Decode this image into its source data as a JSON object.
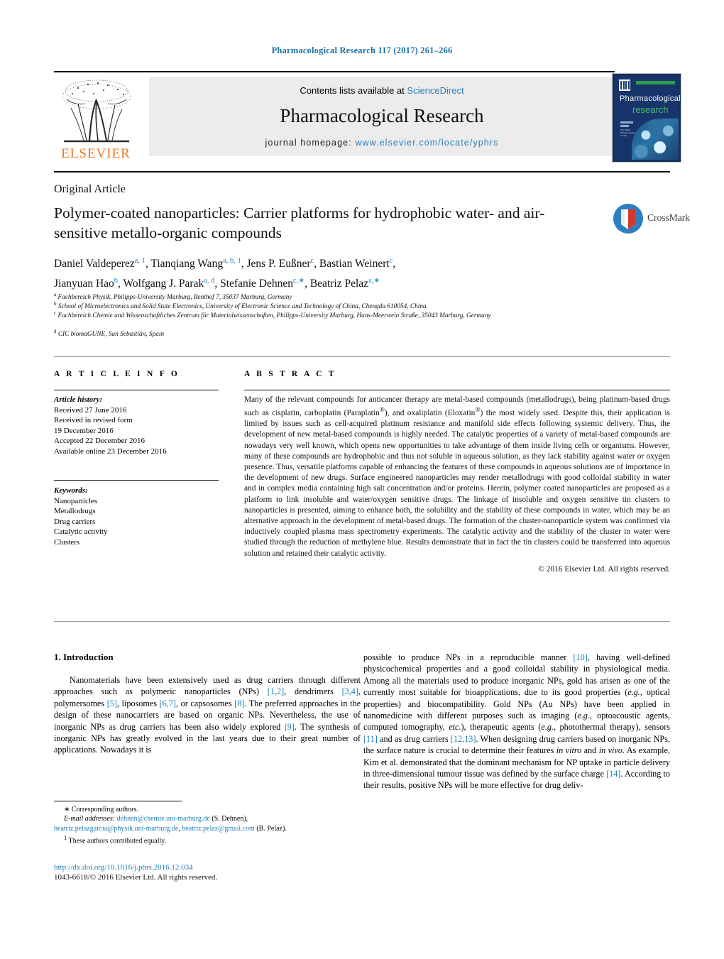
{
  "running_head": "Pharmacological Research 117 (2017) 261–266",
  "masthead": {
    "contents_prefix": "Contents lists available at ",
    "sciencedirect": "ScienceDirect",
    "journal_title": "Pharmacological Research",
    "homepage_label": "journal homepage:",
    "homepage_url": "www.elsevier.com/locate/yphrs",
    "publisher": "ELSEVIER",
    "cover": {
      "line1": "Pharmacological",
      "line2": "research",
      "mini_text": "The Italian Pharmacological Society"
    }
  },
  "article": {
    "type": "Original Article",
    "title": "Polymer-coated nanoparticles: Carrier platforms for hydrophobic water- and air-sensitive metallo-organic compounds",
    "crossmark_label": "CrossMark",
    "authors_line1_html": "Daniel Valdeperez<sup>a, 1</sup>, Tianqiang Wang<sup>a, b, 1</sup>, Jens P. Eußner<sup>c</sup>, Bastian Weinert<sup>c</sup>,",
    "authors_line2_html": "Jianyuan Hao<sup>b</sup>, Wolfgang J. Parak<sup>a, d</sup>, Stefanie Dehnen<sup>c,∗</sup>, Beatriz Pelaz<sup>a,∗</sup>",
    "affiliations": [
      {
        "mark": "a",
        "text": "Fachbereich Physik, Philipps-University Marburg, Renthof 7, 35037 Marburg, Germany"
      },
      {
        "mark": "b",
        "text": "School of Microelectronics and Solid State Electronics, University of Electronic Science and Technology of China, Chengdu 610054, China"
      },
      {
        "mark": "c",
        "text": "Fachbereich Chemie and Wissenschaftliches Zentrum für Materialwissenschaften, Philipps-University Marburg, Hans-Meerwein Straße, 35043 Marburg, Germany"
      },
      {
        "mark": "d",
        "text": "CIC biomaGUNE, San Sebastián, Spain"
      }
    ]
  },
  "article_info": {
    "heading": "A R T I C L E    I N F O",
    "history_label": "Article history:",
    "history": [
      "Received 27 June 2016",
      "Received in revised form",
      "19 December 2016",
      "Accepted 22 December 2016",
      "Available online 23 December 2016"
    ],
    "keywords_label": "Keywords:",
    "keywords": [
      "Nanoparticles",
      "Metallodrugs",
      "Drug carriers",
      "Catalytic activity",
      "Clusters"
    ]
  },
  "abstract": {
    "heading": "A B S T R A C T",
    "text_html": "Many of the relevant compounds for anticancer therapy are metal-based compounds (metallodrugs), being platinum-based drugs such as cisplatin, carboplatin (Paraplatin<sup>®</sup>), and oxaliplatin (Eloxatin<sup>®</sup>) the most widely used. Despite this, their application is limited by issues such as cell-acquired platinum resistance and manifold side effects following systemic delivery. Thus, the development of new metal-based compounds is highly needed. The catalytic properties of a variety of metal-based compounds are nowadays very well known, which opens new opportunities to take advantage of them inside living cells or organisms. However, many of these compounds are hydrophobic and thus not soluble in aqueous solution, as they lack stability against water or oxygen presence. Thus, versatile platforms capable of enhancing the features of these compounds in aqueous solutions are of importance in the development of new drugs. Surface engineered nanoparticles may render metallodrugs with good colloidal stability in water and in complex media containing high salt concentration and/or proteins. Herein, polymer coated nanoparticles are proposed as a platform to link insoluble and water/oxygen sensitive drugs. The linkage of insoluble and oxygen sensitive tin clusters to nanoparticles is presented, aiming to enhance both, the solubility and the stability of these compounds in water, which may be an alternative approach in the development of metal-based drugs. The formation of the cluster-nanoparticle system was confirmed via inductively coupled plasma mass spectrometry experiments. The catalytic activity and the stability of the cluster in water were studied through the reduction of methylene blue. Results demonstrate that in fact the tin clusters could be transferred into aqueous solution and retained their catalytic activity.",
    "copyright": "© 2016 Elsevier Ltd. All rights reserved."
  },
  "body": {
    "section_number_title": "1.  Introduction",
    "left_col_html": "Nanomaterials have been extensively used as drug carriers through different approaches such as polymeric nanoparticles (NPs) <span class=\"ref\">[1,2]</span>, dendrimers <span class=\"ref\">[3,4]</span>, polymersomes <span class=\"ref\">[5]</span>, liposomes <span class=\"ref\">[6,7]</span>, or capsosomes <span class=\"ref\">[8]</span>. The preferred approaches in the design of these nanocarriers are based on organic NPs. Nevertheless, the use of inorganic NPs as drug carriers has been also widely explored <span class=\"ref\">[9]</span>. The synthesis of inorganic NPs has greatly evolved in the last years due to their great number of applications. Nowadays it is",
    "right_col_html": "possible to produce NPs in a reproducible manner <span class=\"ref\">[10]</span>, having well-defined physicochemical properties and a good colloidal stability in physiological media. Among all the materials used to produce inorganic NPs, gold has arisen as one of the currently most suitable for bioapplications, due to its good properties (<span class=\"em\">e.g.</span>, optical properties) and biocompatibility. Gold NPs (Au NPs) have been applied in nanomedicine with different purposes such as imaging (<span class=\"em\">e.g.</span>, optoacoustic agents, computed tomography, <span class=\"em\">etc.</span>), therapeutic agents (<span class=\"em\">e.g.</span>, photothermal therapy), sensors <span class=\"ref\">[11]</span> and as drug carriers <span class=\"ref\">[12,13]</span>. When designing drug carriers based on inorganic NPs, the surface nature is crucial to determine their features <span class=\"em\">in vitro</span> and <span class=\"em\">in vivo</span>. As example, Kim et al. demonstrated that the dominant mechanism for NP uptake in particle delivery in three-dimensional tumour tissue was defined by the surface charge <span class=\"ref\">[14]</span>. According to their results, positive NPs will be more effective for drug deliv-"
  },
  "footnotes": {
    "corresponding": "∗ Corresponding authors.",
    "email_label": "E-mail addresses:",
    "email1": "dehnen@chemie.uni-marburg.de",
    "email1_owner": "(S. Dehnen),",
    "email2": "beatriz.pelazgarcia@physik.uni-marburg.de",
    "email3": "beatriz.pelaz@gmail.com",
    "email3_owner": "(B. Pelaz).",
    "equal_contrib": "These authors contributed equally.",
    "equal_contrib_mark": "1"
  },
  "footer": {
    "doi": "http://dx.doi.org/10.1016/j.phrs.2016.12.034",
    "issn_line": "1043-6618/© 2016 Elsevier Ltd. All rights reserved."
  },
  "colors": {
    "link_blue": "#1d7fb8",
    "header_blue": "#1d6fa5",
    "elsevier_orange": "#e87722",
    "band_gray": "#ececec"
  }
}
